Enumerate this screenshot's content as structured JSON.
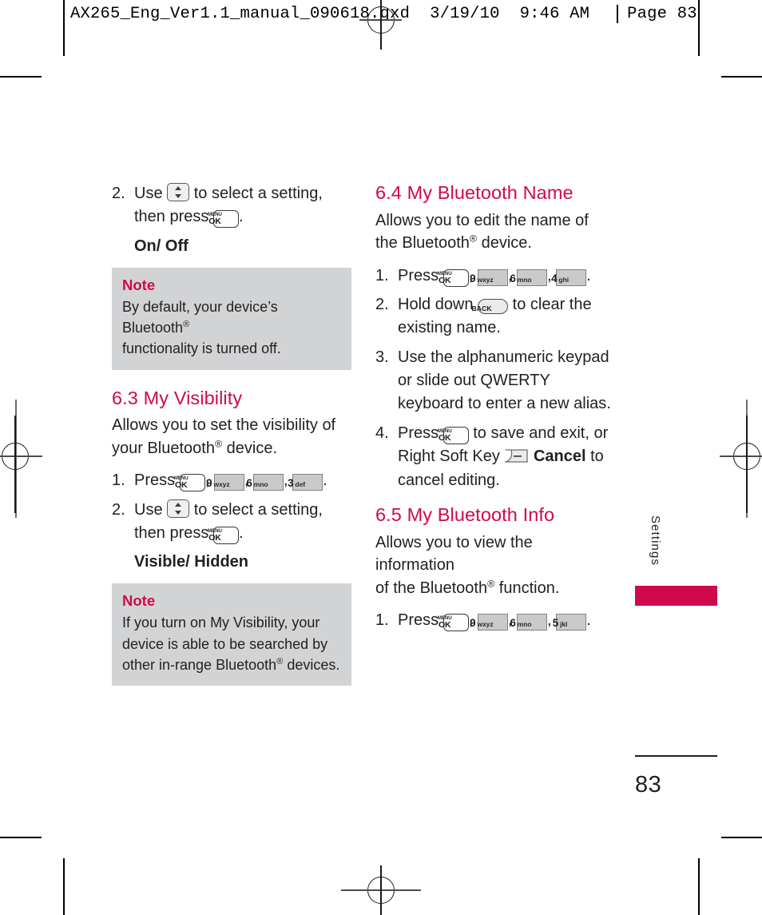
{
  "proof_header": {
    "filename": "AX265_Eng_Ver1.1_manual_090618.qxd",
    "date": "3/19/10",
    "time": "9:46 AM",
    "page_label": "Page",
    "page_number": "83"
  },
  "colors": {
    "accent_crimson": "#cf0a4b",
    "note_background": "#d2d3d4",
    "body_text": "#231f20",
    "key_face_gray": "#c9cacb"
  },
  "keys": {
    "menu_ok": {
      "top_label": "MENU",
      "bottom_label": "OK"
    },
    "nav_updown": {
      "name": "up-down-navigation-key"
    },
    "back": {
      "label": "BACK"
    },
    "right_soft": {
      "name": "right-soft-key"
    },
    "num_9": {
      "digit": "9",
      "letters": "wxyz"
    },
    "num_6": {
      "digit": "6",
      "letters": "mno"
    },
    "num_5": {
      "digit": "5",
      "letters": "jkl"
    },
    "num_4": {
      "digit": "4",
      "letters": "ghi"
    },
    "num_3": {
      "digit": "3",
      "letters": "def"
    }
  },
  "left_column": {
    "step2_num": "2.",
    "step2_text_a": "Use",
    "step2_text_b": "to select a setting,",
    "step2_text_c": "then press",
    "step2_period": ".",
    "options_on_off": "On/ Off",
    "note1": {
      "title": "Note",
      "text_a": "By default, your device’s Bluetooth",
      "reg": "®",
      "text_b": "functionality is turned off."
    },
    "section_63": {
      "heading": "6.3 My Visibility",
      "intro_a": "Allows you to set the visibility of",
      "intro_b": "your Bluetooth",
      "intro_reg": "®",
      "intro_c": " device.",
      "step1_num": "1.",
      "step1_text": "Press",
      "step1_comma": ",",
      "step1_period": ".",
      "step2_num": "2.",
      "step2_text_a": "Use",
      "step2_text_b": "to select a setting,",
      "step2_text_c": "then press",
      "step2_period": ".",
      "options_visible_hidden": "Visible/ Hidden",
      "note2": {
        "title": "Note",
        "text_a": "If you turn on My Visibility, your",
        "text_b": "device is able to be searched by",
        "text_c": "other in-range Bluetooth",
        "reg": "®",
        "text_d": " devices."
      }
    }
  },
  "right_column": {
    "section_64": {
      "heading": "6.4 My Bluetooth Name",
      "intro_a": "Allows you to edit the name of",
      "intro_b": "the Bluetooth",
      "intro_reg": "®",
      "intro_c": " device.",
      "step1_num": "1.",
      "step1_text": "Press",
      "step1_comma": ",",
      "step1_period": ".",
      "step2_num": "2.",
      "step2_text_a": "Hold down",
      "step2_text_b": "to clear the",
      "step2_text_c": "existing name.",
      "step3_num": "3.",
      "step3_text_a": "Use the alphanumeric keypad",
      "step3_text_b": "or slide out QWERTY",
      "step3_text_c": "keyboard to enter a new alias.",
      "step4_num": "4.",
      "step4_text_a": "Press",
      "step4_text_b": "to save and exit, or",
      "step4_text_c": "Right Soft Key",
      "step4_cancel": "Cancel",
      "step4_text_d": "to",
      "step4_text_e": "cancel editing."
    },
    "section_65": {
      "heading": "6.5 My Bluetooth Info",
      "intro_a": "Allows you to view the information",
      "intro_b": "of the Bluetooth",
      "intro_reg": "®",
      "intro_c": " function.",
      "step1_num": "1.",
      "step1_text": "Press",
      "step1_comma": ",",
      "step1_period": "."
    }
  },
  "side_tab": {
    "label": "Settings"
  },
  "folio": {
    "page_number": "83"
  }
}
